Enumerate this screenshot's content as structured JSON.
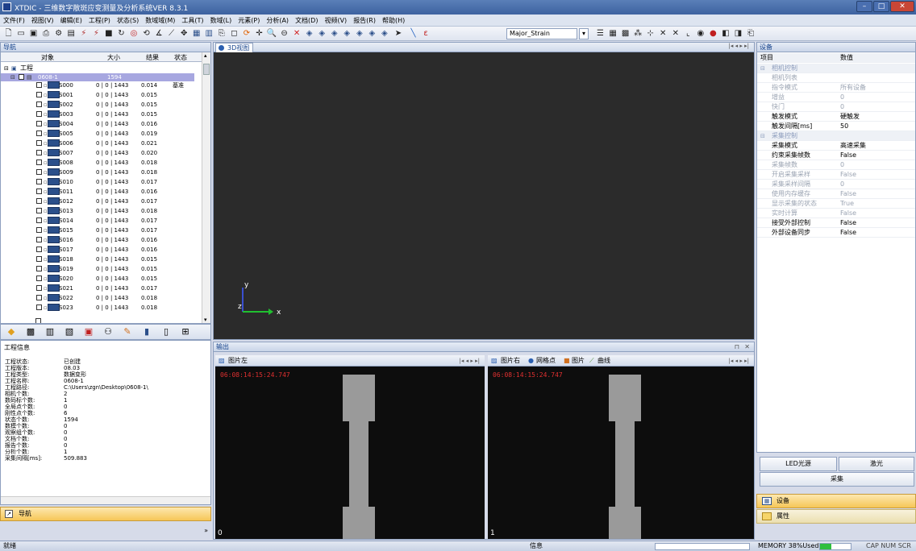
{
  "window": {
    "title": "XTDIC - 三维数字散斑应变测量及分析系统VER 8.3.1"
  },
  "menu": [
    "文件(F)",
    "视图(V)",
    "编辑(E)",
    "工程(P)",
    "状态(S)",
    "数域域(M)",
    "工具(T)",
    "数域(L)",
    "元素(P)",
    "分析(A)",
    "文档(D)",
    "视频(V)",
    "报告(R)",
    "帮助(H)"
  ],
  "toolbar": {
    "strain_combo": "Major_Strain"
  },
  "nav": {
    "title": "导航",
    "columns": [
      "对象",
      "大小",
      "结果",
      "状态"
    ],
    "root": "工程",
    "project": {
      "name": "0608-1",
      "size": "1594"
    },
    "base_label": "基准",
    "rows": [
      {
        "name": "S000",
        "size": "0 | 0 | 1443",
        "result": "0.014"
      },
      {
        "name": "S001",
        "size": "0 | 0 | 1443",
        "result": "0.015"
      },
      {
        "name": "S002",
        "size": "0 | 0 | 1443",
        "result": "0.015"
      },
      {
        "name": "S003",
        "size": "0 | 0 | 1443",
        "result": "0.015"
      },
      {
        "name": "S004",
        "size": "0 | 0 | 1443",
        "result": "0.016"
      },
      {
        "name": "S005",
        "size": "0 | 0 | 1443",
        "result": "0.019"
      },
      {
        "name": "S006",
        "size": "0 | 0 | 1443",
        "result": "0.021"
      },
      {
        "name": "S007",
        "size": "0 | 0 | 1443",
        "result": "0.020"
      },
      {
        "name": "S008",
        "size": "0 | 0 | 1443",
        "result": "0.018"
      },
      {
        "name": "S009",
        "size": "0 | 0 | 1443",
        "result": "0.018"
      },
      {
        "name": "S010",
        "size": "0 | 0 | 1443",
        "result": "0.017"
      },
      {
        "name": "S011",
        "size": "0 | 0 | 1443",
        "result": "0.016"
      },
      {
        "name": "S012",
        "size": "0 | 0 | 1443",
        "result": "0.017"
      },
      {
        "name": "S013",
        "size": "0 | 0 | 1443",
        "result": "0.018"
      },
      {
        "name": "S014",
        "size": "0 | 0 | 1443",
        "result": "0.017"
      },
      {
        "name": "S015",
        "size": "0 | 0 | 1443",
        "result": "0.017"
      },
      {
        "name": "S016",
        "size": "0 | 0 | 1443",
        "result": "0.016"
      },
      {
        "name": "S017",
        "size": "0 | 0 | 1443",
        "result": "0.016"
      },
      {
        "name": "S018",
        "size": "0 | 0 | 1443",
        "result": "0.015"
      },
      {
        "name": "S019",
        "size": "0 | 0 | 1443",
        "result": "0.015"
      },
      {
        "name": "S020",
        "size": "0 | 0 | 1443",
        "result": "0.015"
      },
      {
        "name": "S021",
        "size": "0 | 0 | 1443",
        "result": "0.017"
      },
      {
        "name": "S022",
        "size": "0 | 0 | 1443",
        "result": "0.018"
      },
      {
        "name": "S023",
        "size": "0 | 0 | 1443",
        "result": "0.018"
      }
    ]
  },
  "project_info": {
    "title": "工程信息",
    "items": [
      {
        "k": "工程状态:",
        "v": "已创建"
      },
      {
        "k": "工程版本:",
        "v": "08.03"
      },
      {
        "k": "工程类型:",
        "v": "数据变形"
      },
      {
        "k": "工程名称:",
        "v": "0608-1"
      },
      {
        "k": "工程路径:",
        "v": "C:\\Users\\zgn\\Desktop\\0608-1\\"
      },
      {
        "k": "相机个数:",
        "v": "2"
      },
      {
        "k": "数码标个数:",
        "v": "1"
      },
      {
        "k": "全局点个数:",
        "v": "0"
      },
      {
        "k": "刚性点个数:",
        "v": "6"
      },
      {
        "k": "状态个数:",
        "v": "1594"
      },
      {
        "k": "数模个数:",
        "v": "0"
      },
      {
        "k": "观察组个数:",
        "v": "0"
      },
      {
        "k": "文档个数:",
        "v": "0"
      },
      {
        "k": "报告个数:",
        "v": "0"
      },
      {
        "k": "分析个数:",
        "v": "1"
      },
      {
        "k": "采集间隔[ms]:",
        "v": "509.883"
      }
    ]
  },
  "nav_button": "导航",
  "view3d": {
    "tab": "3D视图",
    "axis_y": "y",
    "axis_z": "z",
    "axis_x": "x"
  },
  "output": {
    "title": "输出",
    "left_tab": "图片左",
    "right_tabs": [
      "图片右",
      "网格点",
      "图片",
      "曲线"
    ],
    "timestamp": "06:08:14:15:24.747",
    "left_index": "0",
    "right_index": "1"
  },
  "device": {
    "title": "设备",
    "columns": [
      "项目",
      "数值"
    ],
    "rows": [
      {
        "k": "相机控制",
        "v": "",
        "type": "grp"
      },
      {
        "k": "相机列表",
        "v": "",
        "type": "dim"
      },
      {
        "k": "指令模式",
        "v": "所有设备",
        "type": "dim"
      },
      {
        "k": "增益",
        "v": "0",
        "type": "dim"
      },
      {
        "k": "快门",
        "v": "0",
        "type": "dim"
      },
      {
        "k": "触发模式",
        "v": "硬触发",
        "type": "b"
      },
      {
        "k": "触发间隔[ms]",
        "v": "50",
        "type": "b"
      },
      {
        "k": "采集控制",
        "v": "",
        "type": "grp"
      },
      {
        "k": "采集模式",
        "v": "高速采集",
        "type": "b"
      },
      {
        "k": "约束采集帧数",
        "v": "False",
        "type": "b"
      },
      {
        "k": "采集帧数",
        "v": "0",
        "type": "dim"
      },
      {
        "k": "开启采集采样",
        "v": "False",
        "type": "dim"
      },
      {
        "k": "采集采样间隔",
        "v": "0",
        "type": "dim"
      },
      {
        "k": "使用内存缓存",
        "v": "False",
        "type": "dim"
      },
      {
        "k": "显示采集的状态",
        "v": "True",
        "type": "dim"
      },
      {
        "k": "实时计算",
        "v": "False",
        "type": "dim"
      },
      {
        "k": "接受外部控制",
        "v": "False",
        "type": "b"
      },
      {
        "k": "外部设备同步",
        "v": "False",
        "type": "b"
      }
    ],
    "btn_led": "LED光源",
    "btn_laser": "激光",
    "btn_capture": "采集",
    "tab_device": "设备",
    "tab_props": "属性"
  },
  "status": {
    "left": "就绪",
    "center": "信息",
    "memory": "MEMORY 38%Used",
    "caps": "CAP NUM SCR"
  }
}
